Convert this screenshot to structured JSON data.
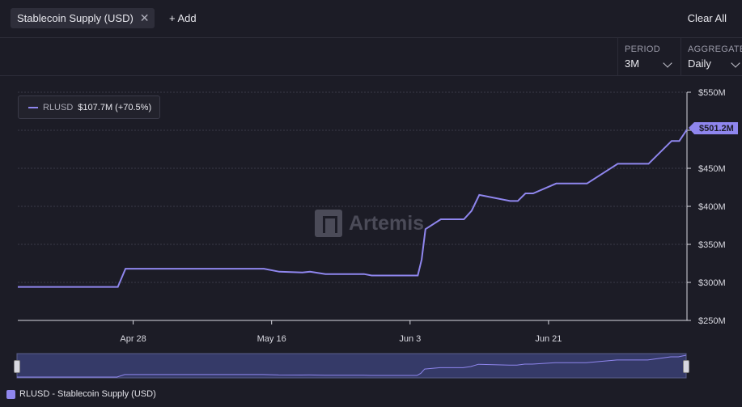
{
  "filter_chip": {
    "label": "Stablecoin Supply (USD)"
  },
  "add_label": "+ Add",
  "clear_all_label": "Clear All",
  "period": {
    "label": "PERIOD",
    "value": "3M"
  },
  "aggregate": {
    "label": "AGGREGATE",
    "value": "Daily"
  },
  "tooltip": {
    "series": "RLUSD",
    "value": "$107.7M (+70.5%)"
  },
  "watermark": "Artemis",
  "last_value_label": "$501.2M",
  "bottom_legend": "RLUSD - Stablecoin Supply (USD)",
  "colors": {
    "series": "#8f86ee",
    "background": "#1c1c26",
    "grid": "#3a3a48"
  },
  "chart_data": {
    "type": "line",
    "series_name": "RLUSD",
    "y_ticks": [
      "$550M",
      "$500M",
      "$450M",
      "$400M",
      "$350M",
      "$300M",
      "$250M"
    ],
    "x_ticks": [
      "Apr 28",
      "May 16",
      "Jun 3",
      "Jun 21"
    ],
    "x_tick_days": [
      15,
      33,
      51,
      69
    ],
    "ylim": [
      250,
      550
    ],
    "y_unit": "$M",
    "x": [
      0,
      3,
      10,
      13,
      14,
      20,
      26,
      32,
      34,
      37,
      38,
      40,
      45,
      46,
      48,
      50,
      52,
      52.5,
      53,
      55,
      58,
      59,
      60,
      64,
      65,
      66,
      67,
      70,
      71,
      73,
      74,
      78,
      79,
      81,
      82,
      85,
      86,
      87
    ],
    "values": [
      294,
      294,
      294,
      294,
      318,
      318,
      318,
      318,
      314,
      313,
      314,
      311,
      311,
      309,
      309,
      309,
      309,
      330,
      370,
      383,
      383,
      394,
      415,
      407,
      407,
      417,
      417,
      430,
      430,
      430,
      430,
      456,
      456,
      456,
      456,
      486,
      486,
      501
    ],
    "grid": true,
    "legend": "top-left"
  }
}
